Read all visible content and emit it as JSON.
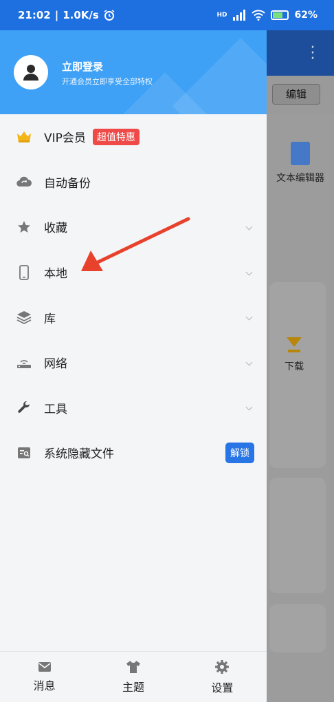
{
  "status_bar": {
    "time": "21:02",
    "speed": "1.0K/s",
    "network": "HD",
    "battery": "62%",
    "battery_level": 0.62
  },
  "background_app": {
    "breadcrumb": "编辑",
    "tool_label": "文本编辑器",
    "download_label": "下载"
  },
  "drawer": {
    "header": {
      "title": "立即登录",
      "subtitle": "开通会员立即享受全部特权"
    },
    "menu": [
      {
        "label": "VIP会员",
        "badge": "超值特惠",
        "icon": "crown-icon"
      },
      {
        "label": "自动备份",
        "icon": "cloud-sync-icon"
      },
      {
        "label": "收藏",
        "icon": "star-icon"
      },
      {
        "label": "本地",
        "icon": "phone-icon"
      },
      {
        "label": "库",
        "icon": "layers-icon"
      },
      {
        "label": "网络",
        "icon": "router-icon"
      },
      {
        "label": "工具",
        "icon": "wrench-icon"
      },
      {
        "label": "系统隐藏文件",
        "badge": "解锁",
        "icon": "hidden-file-icon"
      }
    ],
    "bottom_nav": [
      {
        "label": "消息",
        "icon": "mail-icon"
      },
      {
        "label": "主题",
        "icon": "tshirt-icon"
      },
      {
        "label": "设置",
        "icon": "gear-icon"
      }
    ]
  },
  "colors": {
    "status_bar": "#1e6fe0",
    "header": "#3fa1f5",
    "badge_red": "#ef4a48",
    "badge_blue": "#2875e5",
    "annotation_arrow": "#e8412c"
  }
}
